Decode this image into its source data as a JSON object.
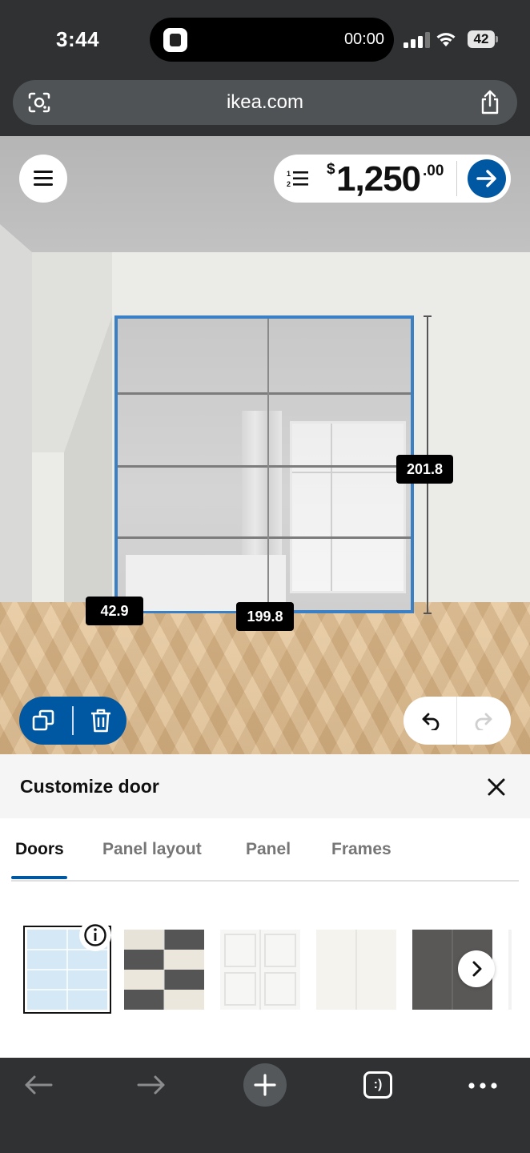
{
  "status_bar": {
    "time": "3:44",
    "timer": "00:00",
    "battery": "42"
  },
  "browser": {
    "url": "ikea.com"
  },
  "scene": {
    "price_currency": "$",
    "price_whole": "1,250",
    "price_cents": ".00",
    "dimensions": {
      "height": "201.8",
      "depth": "42.9",
      "width": "199.8"
    }
  },
  "panel": {
    "title": "Customize door",
    "tabs": [
      {
        "label": "Doors",
        "active": true
      },
      {
        "label": "Panel layout",
        "active": false
      },
      {
        "label": "Panel",
        "active": false
      },
      {
        "label": "Frames",
        "active": false
      }
    ],
    "door_options": [
      {
        "name": "mirror-glass",
        "selected": true
      },
      {
        "name": "checkered-dark-light",
        "selected": false
      },
      {
        "name": "white-frame-panels",
        "selected": false
      },
      {
        "name": "white-plain",
        "selected": false
      },
      {
        "name": "dark-grey",
        "selected": false
      }
    ]
  },
  "colors": {
    "accent": "#0058a3",
    "wardrobe_outline": "#3b7fc4",
    "chrome": "#2f3133"
  },
  "icons": [
    "lens-icon",
    "share-icon",
    "menu-icon",
    "list-icon",
    "arrow-right-icon",
    "copy-icon",
    "trash-icon",
    "undo-icon",
    "redo-icon",
    "close-icon",
    "info-icon",
    "chevron-right-icon",
    "back-icon",
    "forward-icon",
    "plus-icon",
    "tabs-icon",
    "more-icon"
  ]
}
